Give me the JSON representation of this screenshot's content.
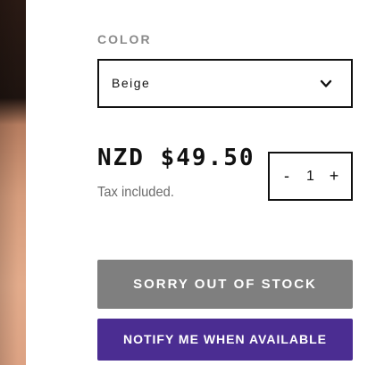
{
  "variant": {
    "label": "COLOR",
    "selected": "Beige"
  },
  "price": {
    "amount": "NZD $49.50",
    "tax_note": "Tax included."
  },
  "quantity": {
    "minus": "-",
    "value": "1",
    "plus": "+"
  },
  "buttons": {
    "out_of_stock": "SORRY OUT OF STOCK",
    "notify": "NOTIFY ME WHEN AVAILABLE"
  },
  "icons": {
    "select": "chevron-down-icon"
  },
  "colors": {
    "notify_button": "#4b2d92",
    "out_of_stock_button": "#7f7f7f",
    "border": "#111111",
    "muted_text": "#8a8a8a"
  }
}
